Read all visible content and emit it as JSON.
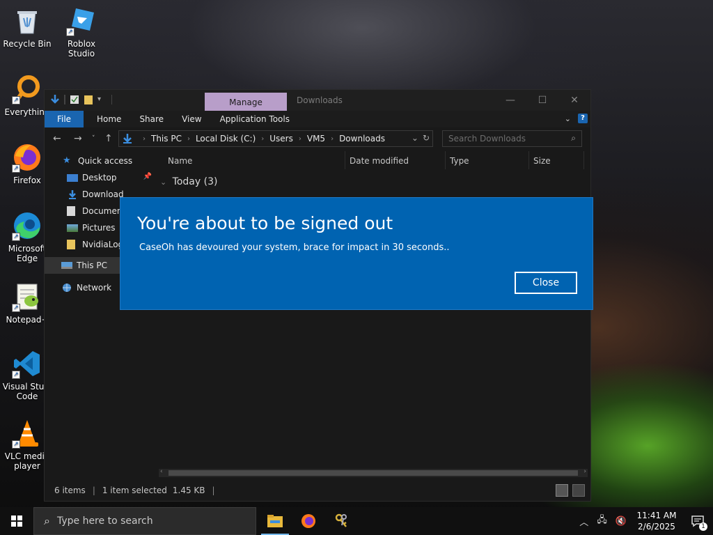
{
  "desktop": {
    "icons": [
      {
        "label": "Recycle Bin"
      },
      {
        "label": "Roblox Studio"
      },
      {
        "label": "Everything"
      },
      {
        "label": "Firefox"
      },
      {
        "label": "Microsoft Edge"
      },
      {
        "label": "Notepad+"
      },
      {
        "label": "Visual Studi Code"
      },
      {
        "label": "VLC media player"
      }
    ]
  },
  "explorer": {
    "title": "Downloads",
    "context_tab": "Manage",
    "ribbon_tabs": [
      "File",
      "Home",
      "Share",
      "View",
      "Application Tools"
    ],
    "address": {
      "crumbs": [
        "This PC",
        "Local Disk (C:)",
        "Users",
        "VM5",
        "Downloads"
      ]
    },
    "search_placeholder": "Search Downloads",
    "nav": {
      "quick_access": "Quick access",
      "items": [
        "Desktop",
        "Download",
        "Document",
        "Pictures",
        "NvidiaLog"
      ],
      "this_pc": "This PC",
      "network": "Network"
    },
    "columns": [
      "Name",
      "Date modified",
      "Type",
      "Size"
    ],
    "group_header": "Today (3)",
    "status": {
      "items": "6 items",
      "selected": "1 item selected",
      "size": "1.45 KB"
    }
  },
  "dialog": {
    "title": "You're about to be signed out",
    "message": "CaseOh has devoured your system, brace for impact in 30 seconds..",
    "close_label": "Close"
  },
  "taskbar": {
    "search_placeholder": "Type here to search",
    "time": "11:41 AM",
    "date": "2/6/2025",
    "notification_count": "1"
  },
  "colors": {
    "dialog_bg": "#0063b1",
    "file_tab": "#1a65b0",
    "manage_tab": "#b89ec9",
    "taskbar": "#101010"
  }
}
